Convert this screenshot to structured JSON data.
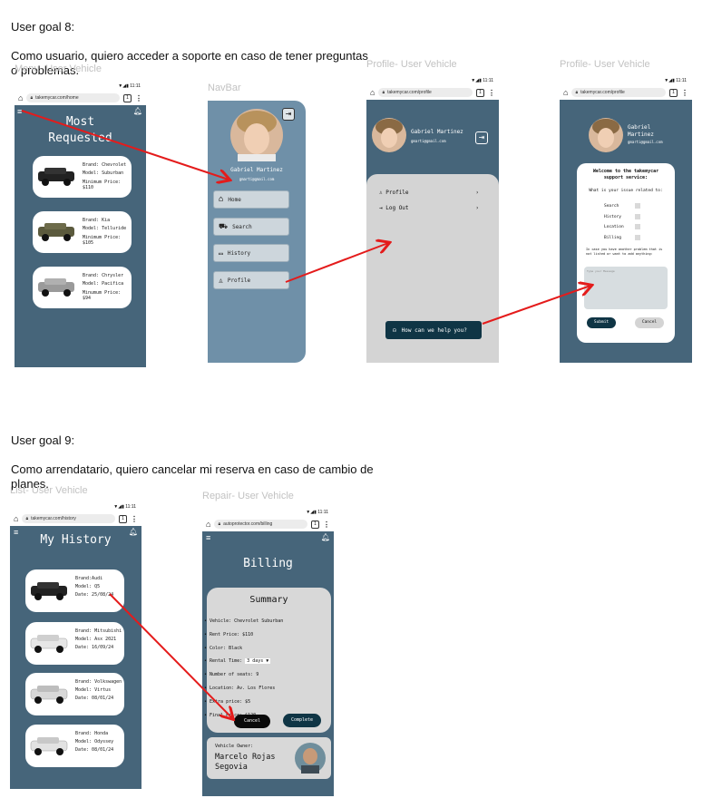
{
  "goal8": {
    "title": "User goal 8:",
    "text": "Como usuario, quiero acceder a soporte en caso de tener preguntas\no problemas."
  },
  "goal9": {
    "title": "User goal 9:",
    "text": "Como arrendatario, quiero cancelar mi reserva en caso de cambio de\nplanes."
  },
  "frames": {
    "menu": "Menu- User Vehicle",
    "navbar": "NavBar",
    "profile1": "Profile- User Vehicle",
    "profile2": "Profile- User Vehicle",
    "list": "List- User Vehicle",
    "repair": "Repair- User Vehicle"
  },
  "status": {
    "time": "11:11"
  },
  "browser": {
    "tab_count": "1",
    "url_home": "takemycar.com/home",
    "url_profile": "takemycar.com/profile",
    "url_history": "takemycar.com/history",
    "url_billing": "autoprotector.com/billing"
  },
  "menu": {
    "title": "Most\nRequested",
    "cars": [
      {
        "brand": "Brand: Chevrolet",
        "model": "Model: Suburban",
        "price": "Minimum Price: $110"
      },
      {
        "brand": "Brand: Kia",
        "model": "Model: Telluride",
        "price": "Minimum Price: $105"
      },
      {
        "brand": "Brand: Chrysler",
        "model": "Model: Pacifica",
        "price": "Minumum Price: $94"
      }
    ]
  },
  "navbar": {
    "name": "Gabriel Martinez",
    "email": "gmarti@gmail.com",
    "items": [
      "Home",
      "Search",
      "History",
      "Profile"
    ]
  },
  "profile1": {
    "name": "Gabriel Martinez",
    "email": "gmarti@gmail.com",
    "menu": [
      "Profile",
      "Log Out"
    ],
    "help_button": "How can we help you?"
  },
  "profile2": {
    "name": "Gabriel\nMartinez",
    "email": "gmarti@gmail.com",
    "dialog_title": "Welcome to the takemycar\nsupport service:",
    "question": "What is your issue related to:",
    "options": [
      "Search",
      "History",
      "Location",
      "Billing"
    ],
    "other_text": "In case you have another problem that is not listed or want to add anything:",
    "message_placeholder": "Type your Message",
    "submit": "Submit",
    "cancel": "Cancel"
  },
  "history": {
    "title": "My History",
    "cars": [
      {
        "brand": "Brand:Audi",
        "model": "Model: Q5",
        "date": "Date: 25/08/24"
      },
      {
        "brand": "Brand: Mitsubishi",
        "model": "Model: Asx 2021",
        "date": "Date: 16/09/24"
      },
      {
        "brand": "Brand: Volkswagen",
        "model": "Model: Virtus",
        "date": "Date: 08/01/24"
      },
      {
        "brand": "Brand: Honda",
        "model": "Model: Odyssey",
        "date": "Date: 08/01/24"
      }
    ]
  },
  "billing": {
    "title": "Billing",
    "summary_title": "Summary",
    "lines": [
      "• Vehicle: Chevrolet Suburban",
      "• Rent Price: $110",
      "• Color: Black",
      "• Rental Time:",
      "• Number of seats: 9",
      "• Location: Av. Los Flores",
      "• Extra price: $5",
      "• Final Price: $120"
    ],
    "rental_time_value": "3 days ▼",
    "cancel": "Cancel",
    "complete": "Complete",
    "owner_label": "Vehicle Owner:",
    "owner_name": "Marcelo Rojas\nSegovia"
  },
  "colors": {
    "screen_bg": "#46657a",
    "navbar_bg": "#6f90a8",
    "dark_button": "#0f3545",
    "arrow": "#e41b1b"
  },
  "icons": [
    "home-icon",
    "lock-icon",
    "menu-icon",
    "bell-icon",
    "logout-icon",
    "search-icon",
    "car-icon",
    "folder-icon",
    "user-icon",
    "headset-icon",
    "chevron-right-icon"
  ]
}
